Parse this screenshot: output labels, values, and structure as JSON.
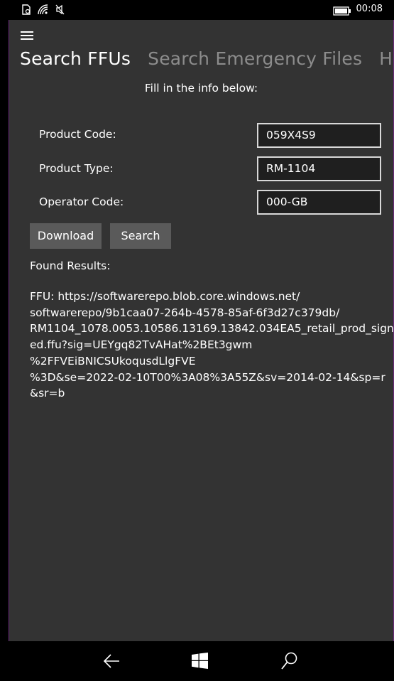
{
  "status_bar": {
    "time": "00:08",
    "icons": [
      "sim-icon",
      "wifi-icon",
      "no-sound-icon",
      "battery-icon"
    ]
  },
  "app": {
    "tabs": [
      {
        "label": "Search FFUs"
      },
      {
        "label": "Search Emergency Files"
      },
      {
        "label": "Home"
      }
    ],
    "instructions": "Fill in the info below:",
    "form": {
      "product_code_label": "Product Code:",
      "product_code_value": "059X4S9",
      "product_type_label": "Product Type:",
      "product_type_value": "RM-1104",
      "operator_code_label": "Operator Code:",
      "operator_code_value": "000-GB"
    },
    "buttons": {
      "download": "Download",
      "search": "Search"
    },
    "results": {
      "title": "Found Results:",
      "text": "FFU: https://softwarerepo.blob.core.windows.net/\nsoftwarerepo/9b1caa07-264b-4578-85af-6f3d27c379db/\nRM1104_1078.0053.10586.13169.13842.034EA5_retail_prod_sign\ned.ffu?sig=UEYgq82TvAHat%2BEt3gwm\n%2FFVEiBNICSUkoqusdLlgFVE\n%3D&se=2022-02-10T00%3A08%3A55Z&sv=2014-02-14&sp=r\n&sr=b"
    }
  },
  "nav_bar": {
    "icons": [
      "back-icon",
      "windows-start-icon",
      "search-icon"
    ]
  },
  "colors": {
    "app_background": "#333333",
    "input_border": "#d8d8d8",
    "button_background": "#5a5a5a",
    "inactive_tab": "#8c8c8c"
  }
}
